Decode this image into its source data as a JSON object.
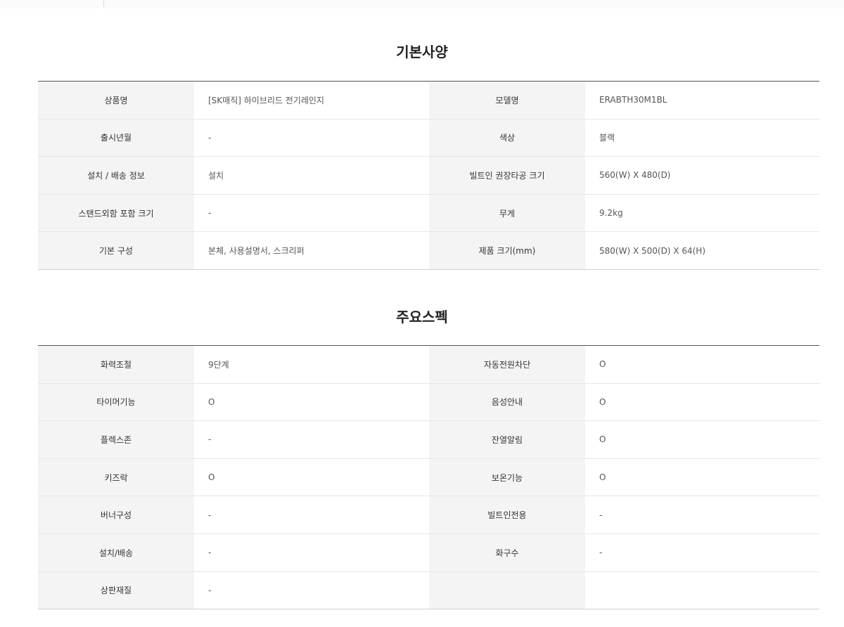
{
  "basic": {
    "title": "기본사양",
    "rows": [
      [
        "상품명",
        "[SK매직] 하이브리드 전기레인지",
        "모델명",
        "ERABTH30M1BL"
      ],
      [
        "출시년월",
        "-",
        "색상",
        "블랙"
      ],
      [
        "설치 / 배송 정보",
        "설치",
        "빌트인 권장타공 크기",
        "560(W) X 480(D)"
      ],
      [
        "스탠드외함 포함 크기",
        "-",
        "무게",
        "9.2kg"
      ],
      [
        "기본 구성",
        "본체, 사용설명서, 스크리퍼",
        "제품 크기(mm)",
        "580(W) X 500(D) X 64(H)"
      ]
    ]
  },
  "specs": {
    "title": "주요스펙",
    "rows": [
      [
        "화력조절",
        "9단계",
        "자동전원차단",
        "O"
      ],
      [
        "타이머기능",
        "O",
        "음성안내",
        "O"
      ],
      [
        "플렉스존",
        "-",
        "잔열알림",
        "O"
      ],
      [
        "키즈락",
        "O",
        "보온기능",
        "O"
      ],
      [
        "버너구성",
        "-",
        "빌트인전용",
        "-"
      ],
      [
        "설치/배송",
        "-",
        "화구수",
        "-"
      ],
      [
        "상판재질",
        "-",
        "",
        ""
      ]
    ]
  }
}
